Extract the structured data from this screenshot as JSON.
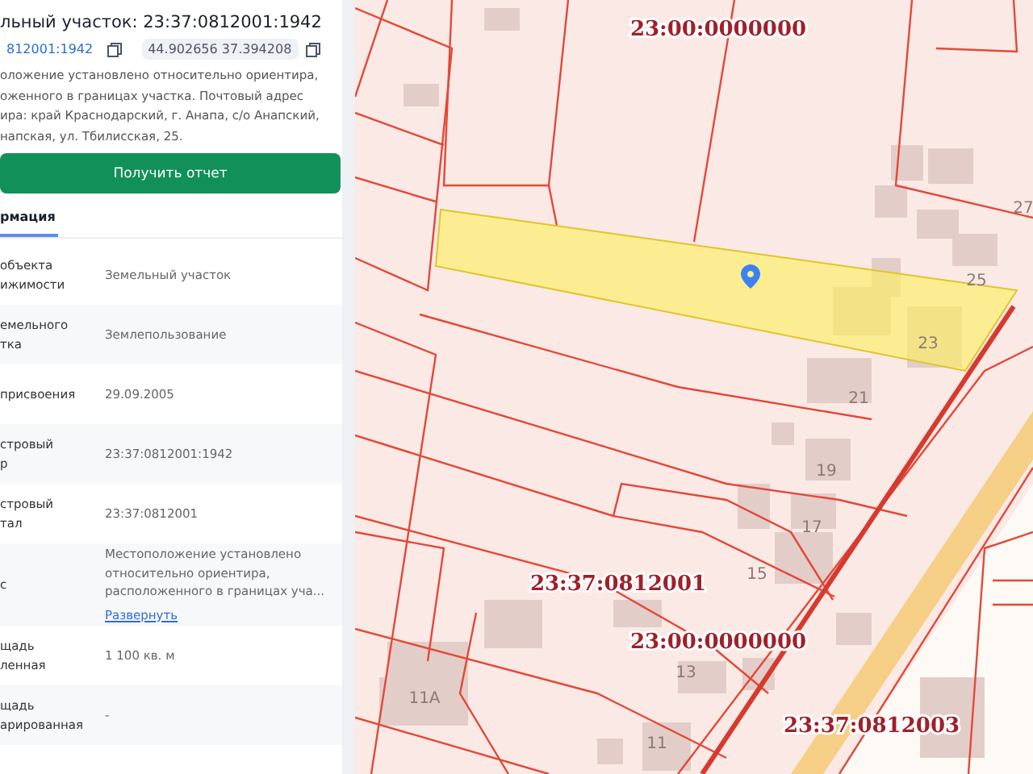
{
  "panel": {
    "title": "льный участок: 23:37:0812001:1942",
    "chips": [
      {
        "kind": "link",
        "text": "812001:1942"
      },
      {
        "kind": "plain",
        "text": "44.902656 37.394208"
      }
    ],
    "description_lines": [
      "оложение установлено относительно ориентира,",
      "оженного в границах участка. Почтовый адрес",
      "ира: край Краснодарский, г. Анапа, с/о Анапский,",
      "напская, ул. Тбилисская, 25."
    ],
    "report_button": "Получить отчет",
    "tabs": [
      {
        "label": "рмация",
        "selected": true
      }
    ],
    "rows": [
      {
        "label_lines": [
          "объекта",
          "ижимости"
        ],
        "value": "Земельный участок"
      },
      {
        "label_lines": [
          "емельного",
          "тка"
        ],
        "value": "Землепользование"
      },
      {
        "label_lines": [
          "присвоения"
        ],
        "value": "29.09.2005"
      },
      {
        "label_lines": [
          "стровый",
          "р"
        ],
        "value": "23:37:0812001:1942"
      },
      {
        "label_lines": [
          "стровый",
          "тал"
        ],
        "value": "23:37:0812001"
      },
      {
        "label_lines": [
          "с"
        ],
        "value": "Местоположение установлено относительно ориентира, расположенного в границах уча...",
        "link": "Развернуть"
      },
      {
        "label_lines": [
          "щадь",
          "ленная"
        ],
        "value": "1 100 кв. м"
      },
      {
        "label_lines": [
          "щадь",
          "арированная"
        ],
        "value": "-"
      }
    ]
  },
  "map": {
    "cadastral_labels": [
      "23:00:0000000",
      "23:37:0812001",
      "23:00:0000000",
      "23:37:0812003"
    ],
    "house_numbers": [
      "27",
      "25",
      "23",
      "21",
      "19",
      "17",
      "15",
      "13",
      "11",
      "11А"
    ]
  }
}
